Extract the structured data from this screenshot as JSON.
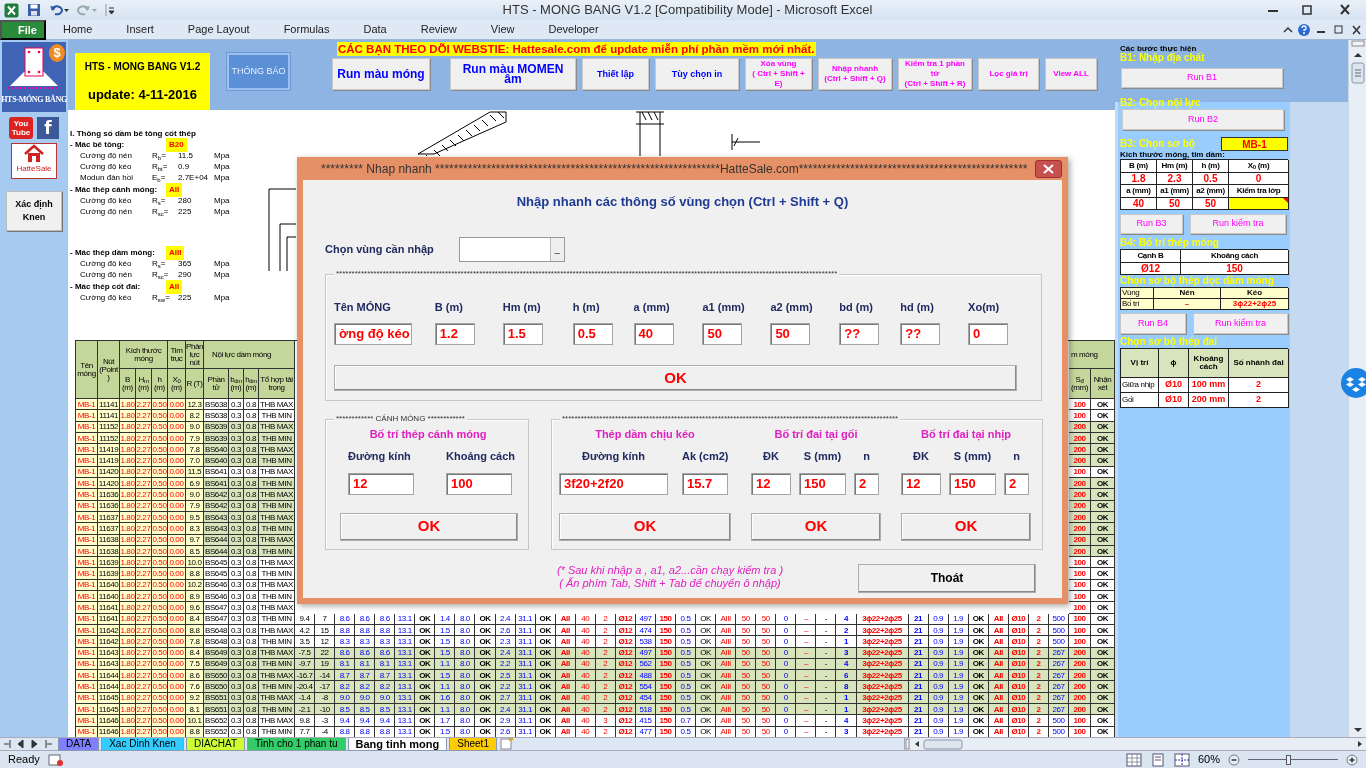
{
  "window": {
    "title": "HTS - MONG BANG V1.2  [Compatibility Mode]  -  Microsoft Excel"
  },
  "ribbon_tabs": [
    {
      "label": "File",
      "kind": "file"
    },
    {
      "label": "Home",
      "kind": "tab"
    },
    {
      "label": "Insert",
      "kind": "tab"
    },
    {
      "label": "Page Layout",
      "kind": "tab"
    },
    {
      "label": "Formulas",
      "kind": "tab"
    },
    {
      "label": "Data",
      "kind": "tab"
    },
    {
      "label": "Review",
      "kind": "tab"
    },
    {
      "label": "View",
      "kind": "tab"
    },
    {
      "label": "Developer",
      "kind": "tab"
    }
  ],
  "side": {
    "logo_caption": "HTS-MÓNG BĂNG",
    "logo_badge": "$",
    "links": [
      {
        "kind": "youtube",
        "label": "You Tube"
      },
      {
        "kind": "facebook",
        "label": "f"
      }
    ],
    "shop_caption": "HatteSale",
    "knen_button": "Xác định Knen"
  },
  "banner": {
    "title": "HTS - MONG BANG V1.2",
    "update": "update: 4-11-2016",
    "notice_button": "THÔNG BÁO",
    "marquee": "CÁC BẠN THEO DÕI WEBSTIE: Hattesale.com để update miễn phí phần mềm mới nhất.",
    "buttons": [
      {
        "label": "Run màu móng",
        "kind": "large"
      },
      {
        "label": "Run màu MOMEN âm",
        "kind": "large"
      },
      {
        "label": "Thiết lập",
        "kind": "small"
      },
      {
        "label": "Tùy chọn in",
        "kind": "small"
      },
      {
        "label": "Xóa vùng\n( Ctrl + Shift + E)",
        "kind": "shortcut"
      },
      {
        "label": "Nhập nhanh\n(Ctrl + Shift + Q)",
        "kind": "shortcut"
      },
      {
        "label": "Kiểm tra 1 phần tử\n(Ctrl + Shift + R)",
        "kind": "shortcut"
      },
      {
        "label": "Lọc giá trị",
        "kind": "shortcut"
      },
      {
        "label": "View ALL",
        "kind": "shortcut"
      }
    ]
  },
  "params": {
    "heading": "I. Thông số dầm bê tông cốt thép",
    "groups": [
      {
        "label": "- Mác bê tông:",
        "grade": "B20",
        "items": [
          {
            "label": "Cường độ nén",
            "symbol": "R$_{b}$=",
            "value": "11.5",
            "unit": "Mpa"
          },
          {
            "label": "Cường độ kéo",
            "symbol": "R$_{bt}$=",
            "value": "0.9",
            "unit": "Mpa"
          },
          {
            "label": "Modun đàn hồi",
            "symbol": "E$_{b}$=",
            "value": "2.7E+04",
            "unit": "Mpa"
          }
        ]
      },
      {
        "label": "- Mác thép cánh móng:",
        "grade": "AII",
        "items": [
          {
            "label": "Cường độ kéo",
            "symbol": "R$_{s}$=",
            "value": "280",
            "unit": "Mpa"
          },
          {
            "label": "Cường độ nén",
            "symbol": "R$_{sc}$=",
            "value": "225",
            "unit": "Mpa"
          }
        ]
      },
      {
        "label": "- Mác thép dầm móng:",
        "grade": "AIII",
        "items": [
          {
            "label": "Cường độ kéo",
            "symbol": "R$_{s}$=",
            "value": "365",
            "unit": "Mpa"
          },
          {
            "label": "Cường độ nén",
            "symbol": "R$_{sc}$=",
            "value": "290",
            "unit": "Mpa"
          }
        ]
      },
      {
        "label": "- Mác thép cốt đai:",
        "grade": "AII",
        "items": [
          {
            "label": "Cường độ kéo",
            "symbol": "R$_{sw}$=",
            "value": "225",
            "unit": "Mpa"
          }
        ]
      }
    ]
  },
  "table": {
    "left_columns": [
      {
        "label": "Tên móng"
      },
      {
        "label": "Nút (Point )"
      },
      {
        "label": "Kích thước móng",
        "children": [
          {
            "label": "B (m)"
          },
          {
            "label": "H$_{m}$ (m)"
          },
          {
            "label": "h (m)"
          }
        ]
      },
      {
        "label": "Tim trục",
        "children": [
          {
            "label": "X$_{0}$ (m)"
          }
        ]
      },
      {
        "label": "Phản lực nút",
        "children": [
          {
            "label": "R (T)"
          }
        ]
      },
      {
        "label": "Nội lực dầm móng",
        "children": [
          {
            "label": "Phần tử"
          },
          {
            "label": "b$_{dm}$ (m)"
          },
          {
            "label": "h$_{dm}$ (m)"
          },
          {
            "label": "Tổ hợp tải trọng"
          }
        ]
      }
    ],
    "right_columns": [
      {
        "label": "m móng",
        "children": [
          {
            "label": "S$_{đ}$ (mm)"
          },
          {
            "label": "Nhận xét"
          }
        ]
      }
    ],
    "rows": [
      {
        "kind": "partial",
        "highlighted": false,
        "cells": [
          "MB-1",
          "11141",
          "1.80",
          "2.27",
          "0.50",
          "0.00",
          "12.3",
          "BS638",
          "0.3",
          "0.8",
          "THB MAX",
          "100",
          "OK"
        ]
      },
      {
        "kind": "partial",
        "highlighted": false,
        "cells": [
          "MB-1",
          "11141",
          "1.80",
          "2.27",
          "0.50",
          "0.00",
          "8.2",
          "BS638",
          "0.3",
          "0.8",
          "THB MIN",
          "100",
          "OK"
        ]
      },
      {
        "kind": "partial",
        "highlighted": true,
        "cells": [
          "MB-1",
          "11152",
          "1.80",
          "2.27",
          "0.50",
          "0.00",
          "9.0",
          "BS639",
          "0.3",
          "0.8",
          "THB MAX",
          "200",
          "OK"
        ]
      },
      {
        "kind": "partial",
        "highlighted": true,
        "cells": [
          "MB-1",
          "11152",
          "1.80",
          "2.27",
          "0.50",
          "0.00",
          "7.9",
          "BS639",
          "0.3",
          "0.8",
          "THB MIN",
          "200",
          "OK"
        ]
      },
      {
        "kind": "partial",
        "highlighted": true,
        "cells": [
          "MB-1",
          "11419",
          "1.80",
          "2.27",
          "0.50",
          "0.00",
          "7.8",
          "BS640",
          "0.3",
          "0.8",
          "THB MAX",
          "200",
          "OK"
        ]
      },
      {
        "kind": "partial",
        "highlighted": true,
        "cells": [
          "MB-1",
          "11419",
          "1.80",
          "2.27",
          "0.50",
          "0.00",
          "7.0",
          "BS640",
          "0.3",
          "0.8",
          "THB MIN",
          "200",
          "OK"
        ]
      },
      {
        "kind": "partial",
        "highlighted": false,
        "cells": [
          "MB-1",
          "11420",
          "1.80",
          "2.27",
          "0.50",
          "0.00",
          "11.5",
          "BS641",
          "0.3",
          "0.8",
          "THB MAX",
          "100",
          "OK"
        ]
      },
      {
        "kind": "partial",
        "highlighted": true,
        "cells": [
          "MB-1",
          "11420",
          "1.80",
          "2.27",
          "0.50",
          "0.00",
          "6.9",
          "BS641",
          "0.3",
          "0.8",
          "THB MIN",
          "200",
          "OK"
        ]
      },
      {
        "kind": "partial",
        "highlighted": true,
        "cells": [
          "MB-1",
          "11636",
          "1.80",
          "2.27",
          "0.50",
          "0.00",
          "9.0",
          "BS642",
          "0.3",
          "0.8",
          "THB MAX",
          "200",
          "OK"
        ]
      },
      {
        "kind": "partial",
        "highlighted": true,
        "cells": [
          "MB-1",
          "11636",
          "1.80",
          "2.27",
          "0.50",
          "0.00",
          "7.9",
          "BS642",
          "0.3",
          "0.8",
          "THB MIN",
          "200",
          "OK"
        ]
      },
      {
        "kind": "partial",
        "highlighted": true,
        "cells": [
          "MB-1",
          "11637",
          "1.80",
          "2.27",
          "0.50",
          "0.00",
          "9.5",
          "BS643",
          "0.3",
          "0.8",
          "THB MAX",
          "200",
          "OK"
        ]
      },
      {
        "kind": "partial",
        "highlighted": true,
        "cells": [
          "MB-1",
          "11637",
          "1.80",
          "2.27",
          "0.50",
          "0.00",
          "8.3",
          "BS643",
          "0.3",
          "0.8",
          "THB MIN",
          "200",
          "OK"
        ]
      },
      {
        "kind": "partial",
        "highlighted": true,
        "cells": [
          "MB-1",
          "11638",
          "1.80",
          "2.27",
          "0.50",
          "0.00",
          "9.7",
          "BS644",
          "0.3",
          "0.8",
          "THB MAX",
          "200",
          "OK"
        ]
      },
      {
        "kind": "partial",
        "highlighted": true,
        "cells": [
          "MB-1",
          "11638",
          "1.80",
          "2.27",
          "0.50",
          "0.00",
          "8.5",
          "BS644",
          "0.3",
          "0.8",
          "THB MIN",
          "200",
          "OK"
        ]
      },
      {
        "kind": "partial",
        "highlighted": false,
        "cells": [
          "MB-1",
          "11639",
          "1.80",
          "2.27",
          "0.50",
          "0.00",
          "10.0",
          "BS645",
          "0.3",
          "0.8",
          "THB MAX",
          "100",
          "OK"
        ]
      },
      {
        "kind": "partial",
        "highlighted": false,
        "cells": [
          "MB-1",
          "11639",
          "1.80",
          "2.27",
          "0.50",
          "0.00",
          "8.8",
          "BS645",
          "0.3",
          "0.8",
          "THB MIN",
          "100",
          "OK"
        ]
      },
      {
        "kind": "partial",
        "highlighted": false,
        "cells": [
          "MB-1",
          "11640",
          "1.80",
          "2.27",
          "0.50",
          "0.00",
          "10.2",
          "BS646",
          "0.3",
          "0.8",
          "THB MAX",
          "100",
          "OK"
        ]
      },
      {
        "kind": "partial",
        "highlighted": false,
        "cells": [
          "MB-1",
          "11640",
          "1.80",
          "2.27",
          "0.50",
          "0.00",
          "8.9",
          "BS646",
          "0.3",
          "0.8",
          "THB MIN",
          "100",
          "OK"
        ]
      },
      {
        "kind": "partial",
        "highlighted": false,
        "cells": [
          "MB-1",
          "11641",
          "1.80",
          "2.27",
          "0.50",
          "0.00",
          "9.6",
          "BS647",
          "0.3",
          "0.8",
          "THB MAX",
          "100",
          "OK"
        ]
      },
      {
        "kind": "full",
        "highlighted": false,
        "cells": [
          "MB-1",
          "11641",
          "1.80",
          "2.27",
          "0.50",
          "0.00",
          "8.4",
          "BS647",
          "0.3",
          "0.8",
          "THB MIN",
          "9.4",
          "7",
          "8.6",
          "8.6",
          "8.6",
          "13.1",
          "OK",
          "1.4",
          "8.0",
          "OK",
          "2.4",
          "31.1",
          "OK",
          "AII",
          "40",
          "2",
          "Ø12",
          "497",
          "150",
          "0.5",
          "OK",
          "AIII",
          "50",
          "50",
          "0",
          "–",
          "-",
          "4",
          "3ϕ22+2ϕ25",
          "21",
          "0.9",
          "1.9",
          "OK",
          "AII",
          "Ø10",
          "2",
          "500",
          "100",
          "OK"
        ]
      },
      {
        "kind": "full",
        "highlighted": false,
        "cells": [
          "MB-1",
          "11642",
          "1.80",
          "2.27",
          "0.50",
          "0.00",
          "8.8",
          "BS648",
          "0.3",
          "0.8",
          "THB MAX",
          "4.2",
          "15",
          "8.8",
          "8.8",
          "8.8",
          "13.1",
          "OK",
          "1.5",
          "8.0",
          "OK",
          "2.6",
          "31.1",
          "OK",
          "AII",
          "40",
          "2",
          "Ø12",
          "474",
          "150",
          "0.5",
          "OK",
          "AIII",
          "50",
          "50",
          "0",
          "–",
          "-",
          "2",
          "3ϕ22+2ϕ25",
          "21",
          "0.9",
          "1.9",
          "OK",
          "AII",
          "Ø10",
          "2",
          "500",
          "100",
          "OK"
        ]
      },
      {
        "kind": "full",
        "highlighted": false,
        "cells": [
          "MB-1",
          "11642",
          "1.80",
          "2.27",
          "0.50",
          "0.00",
          "7.8",
          "BS648",
          "0.3",
          "0.8",
          "THB MIN",
          "3.5",
          "12",
          "8.3",
          "8.3",
          "8.3",
          "13.1",
          "OK",
          "1.5",
          "8.0",
          "OK",
          "2.3",
          "31.1",
          "OK",
          "AII",
          "40",
          "2",
          "Ø12",
          "538",
          "150",
          "0.5",
          "OK",
          "AIII",
          "50",
          "50",
          "0",
          "–",
          "-",
          "1",
          "3ϕ22+2ϕ25",
          "21",
          "0.9",
          "1.9",
          "OK",
          "AII",
          "Ø10",
          "2",
          "500",
          "100",
          "OK"
        ]
      },
      {
        "kind": "full",
        "highlighted": true,
        "cells": [
          "MB-1",
          "11643",
          "1.80",
          "2.27",
          "0.50",
          "0.00",
          "8.4",
          "BS649",
          "0.3",
          "0.8",
          "THB MAX",
          "-7.5",
          "22",
          "8.6",
          "8.6",
          "8.6",
          "13.1",
          "OK",
          "1.5",
          "8.0",
          "OK",
          "2.4",
          "31.1",
          "OK",
          "AII",
          "40",
          "2",
          "Ø12",
          "497",
          "150",
          "0.5",
          "OK",
          "AIII",
          "50",
          "50",
          "0",
          "–",
          "-",
          "3",
          "3ϕ22+2ϕ25",
          "21",
          "0.9",
          "1.9",
          "OK",
          "AII",
          "Ø10",
          "2",
          "267",
          "200",
          "OK"
        ]
      },
      {
        "kind": "full",
        "highlighted": true,
        "cells": [
          "MB-1",
          "11643",
          "1.80",
          "2.27",
          "0.50",
          "0.00",
          "7.5",
          "BS649",
          "0.3",
          "0.8",
          "THB MIN",
          "-9.7",
          "19",
          "8.1",
          "8.1",
          "8.1",
          "13.1",
          "OK",
          "1.1",
          "8.0",
          "OK",
          "2.2",
          "31.1",
          "OK",
          "AII",
          "40",
          "2",
          "Ø12",
          "562",
          "150",
          "0.5",
          "OK",
          "AIII",
          "50",
          "50",
          "0",
          "–",
          "-",
          "4",
          "3ϕ22+2ϕ25",
          "21",
          "0.9",
          "1.9",
          "OK",
          "AII",
          "Ø10",
          "2",
          "267",
          "200",
          "OK"
        ]
      },
      {
        "kind": "full",
        "highlighted": true,
        "cells": [
          "MB-1",
          "11644",
          "1.80",
          "2.27",
          "0.50",
          "0.00",
          "8.6",
          "BS650",
          "0.3",
          "0.8",
          "THB MAX",
          "-16.7",
          "-14",
          "8.7",
          "8.7",
          "8.7",
          "13.1",
          "OK",
          "1.5",
          "8.0",
          "OK",
          "2.5",
          "31.1",
          "OK",
          "AII",
          "40",
          "2",
          "Ø12",
          "488",
          "150",
          "0.5",
          "OK",
          "AIII",
          "50",
          "50",
          "0",
          "–",
          "-",
          "6",
          "3ϕ22+2ϕ25",
          "21",
          "0.9",
          "1.9",
          "OK",
          "AII",
          "Ø10",
          "2",
          "267",
          "200",
          "OK"
        ]
      },
      {
        "kind": "full",
        "highlighted": true,
        "cells": [
          "MB-1",
          "11644",
          "1.80",
          "2.27",
          "0.50",
          "0.00",
          "7.6",
          "BS650",
          "0.3",
          "0.8",
          "THB MIN",
          "-20.4",
          "-17",
          "8.2",
          "8.2",
          "8.2",
          "13.1",
          "OK",
          "1.1",
          "8.0",
          "OK",
          "2.2",
          "31.1",
          "OK",
          "AII",
          "40",
          "2",
          "Ø12",
          "554",
          "150",
          "0.5",
          "OK",
          "AIII",
          "50",
          "50",
          "0",
          "–",
          "-",
          "8",
          "3ϕ22+2ϕ25",
          "21",
          "0.9",
          "1.9",
          "OK",
          "AII",
          "Ø10",
          "2",
          "267",
          "200",
          "OK"
        ]
      },
      {
        "kind": "full",
        "highlighted": true,
        "cells": [
          "MB-1",
          "11645",
          "1.80",
          "2.27",
          "0.50",
          "0.00",
          "9.2",
          "BS651",
          "0.3",
          "0.8",
          "THB MAX",
          "-1.4",
          "-8",
          "9.0",
          "9.0",
          "9.0",
          "13.1",
          "OK",
          "1.6",
          "8.0",
          "OK",
          "2.7",
          "31.1",
          "OK",
          "AII",
          "40",
          "2",
          "Ø12",
          "454",
          "150",
          "0.5",
          "OK",
          "AIII",
          "50",
          "50",
          "0",
          "–",
          "-",
          "1",
          "3ϕ22+2ϕ25",
          "21",
          "0.9",
          "1.9",
          "OK",
          "AII",
          "Ø10",
          "2",
          "267",
          "200",
          "OK"
        ]
      },
      {
        "kind": "full",
        "highlighted": true,
        "cells": [
          "MB-1",
          "11645",
          "1.80",
          "2.27",
          "0.50",
          "0.00",
          "8.1",
          "BS651",
          "0.3",
          "0.8",
          "THB MIN",
          "-2.1",
          "-10",
          "8.5",
          "8.5",
          "8.5",
          "13.1",
          "OK",
          "1.1",
          "8.0",
          "OK",
          "2.4",
          "31.1",
          "OK",
          "AII",
          "40",
          "2",
          "Ø12",
          "518",
          "150",
          "0.5",
          "OK",
          "AIII",
          "50",
          "50",
          "0",
          "–",
          "-",
          "1",
          "3ϕ22+2ϕ25",
          "21",
          "0.9",
          "1.9",
          "OK",
          "AII",
          "Ø10",
          "2",
          "267",
          "200",
          "OK"
        ]
      },
      {
        "kind": "full",
        "highlighted": false,
        "cells": [
          "MB-1",
          "11646",
          "1.80",
          "2.27",
          "0.50",
          "0.00",
          "10.1",
          "BS652",
          "0.3",
          "0.8",
          "THB MAX",
          "9.8",
          "-3",
          "9.4",
          "9.4",
          "9.4",
          "13.1",
          "OK",
          "1.7",
          "8.0",
          "OK",
          "2.9",
          "31.1",
          "OK",
          "AII",
          "40",
          "3",
          "Ø12",
          "415",
          "150",
          "0.7",
          "OK",
          "AIII",
          "50",
          "50",
          "0",
          "–",
          "-",
          "4",
          "3ϕ22+2ϕ25",
          "21",
          "0.9",
          "1.9",
          "OK",
          "AII",
          "Ø10",
          "2",
          "500",
          "100",
          "OK"
        ]
      },
      {
        "kind": "full",
        "highlighted": false,
        "cells": [
          "MB-1",
          "11646",
          "1.80",
          "2.27",
          "0.50",
          "0.00",
          "8.8",
          "BS652",
          "0.3",
          "0.8",
          "THB MIN",
          "7.7",
          "-4",
          "8.8",
          "8.8",
          "8.8",
          "13.1",
          "OK",
          "1.5",
          "8.0",
          "OK",
          "2.6",
          "31.1",
          "OK",
          "AII",
          "40",
          "2",
          "Ø12",
          "477",
          "150",
          "0.5",
          "OK",
          "AIII",
          "50",
          "50",
          "0",
          "–",
          "-",
          "3",
          "3ϕ22+2ϕ25",
          "21",
          "0.9",
          "1.9",
          "OK",
          "AII",
          "Ø10",
          "2",
          "500",
          "100",
          "OK"
        ]
      }
    ]
  },
  "dialog": {
    "title": "********* Nhap nhanh *************************************************************HatteSale.com*************************************************",
    "heading": "Nhập nhanh các thông số vùng chọn (Ctrl + Shift + Q)",
    "range_label": "Chọn vùng cần nhập",
    "range_button": "_",
    "main_frame": {
      "caption": "*****************************************************************************************************************************************************************",
      "fields": [
        {
          "label": "Tên MÓNG",
          "value": "ờng độ kéo"
        },
        {
          "label": "B (m)",
          "value": "1.2"
        },
        {
          "label": "Hm (m)",
          "value": "1.5"
        },
        {
          "label": "h (m)",
          "value": "0.5"
        },
        {
          "label": "a (mm)",
          "value": "40"
        },
        {
          "label": "a1 (mm)",
          "value": "50"
        },
        {
          "label": "a2 (mm)",
          "value": "50"
        },
        {
          "label": "bd (m)",
          "value": "??"
        },
        {
          "label": "hd (m)",
          "value": "??"
        },
        {
          "label": "Xo(m)",
          "value": "0"
        }
      ],
      "ok": "OK"
    },
    "wing_frame": {
      "caption": "************ CÁNH MÓNG ************",
      "heading": "Bố trí thép cánh móng",
      "fields": [
        {
          "label": "Đường kính",
          "value": "12"
        },
        {
          "label": "Khoảng cách",
          "value": "100"
        }
      ],
      "ok": "OK"
    },
    "beam_frame": {
      "caption": "************************************************************************************************************",
      "groups": [
        {
          "heading": "Thép dầm chịu kéo",
          "fields": [
            {
              "label": "Đường kính",
              "value": "3f20+2f20"
            },
            {
              "label": "Ak (cm2)",
              "value": "15.7"
            }
          ],
          "ok": "OK"
        },
        {
          "heading": "Bố trí đai tại gối",
          "fields": [
            {
              "label": "ĐK",
              "value": "12"
            },
            {
              "label": "S (mm)",
              "value": "150"
            },
            {
              "label": "n",
              "value": "2"
            }
          ],
          "ok": "OK"
        },
        {
          "heading": "Bố trí đai tại nhịp",
          "fields": [
            {
              "label": "ĐK",
              "value": "12"
            },
            {
              "label": "S (mm)",
              "value": "150"
            },
            {
              "label": "n",
              "value": "2"
            }
          ],
          "ok": "OK"
        }
      ]
    },
    "notes": [
      "(* Sau khi nhập a , a1, a2...cần chạy kiểm tra )",
      "( Ấn phím Tab, Shift + Tab để chuyển ô  nhập)"
    ],
    "exit_button": "Thoát"
  },
  "panel": {
    "caption": "Các bước thực hiện",
    "b1": "B1: Nhập địa chất",
    "b1_button": "Run B1",
    "b2": "B2: Chọn nội lực",
    "b2_button": "Run B2",
    "b3": "B3: Chọn sơ bộ",
    "b3_value": "MB-1",
    "size_caption": "Kích thước móng, tim dầm:",
    "size_table": [
      {
        "kind": "head",
        "cells": [
          "B (m)",
          "Hm (m)",
          "h (m)",
          "X$_{0}$ (m)"
        ]
      },
      {
        "kind": "value",
        "cells": [
          "1.8",
          "2.3",
          "0.5",
          "0"
        ]
      },
      {
        "kind": "head",
        "cells": [
          "a (mm)",
          "a1 (mm)",
          "a2 (mm)",
          "Kiểm tra lớp"
        ]
      },
      {
        "kind": "value",
        "flagged": true,
        "cells": [
          "40",
          "50",
          "50"
        ]
      }
    ],
    "b3_buttons": [
      "Run B3",
      "Run kiểm tra"
    ],
    "b4": "B4: Bố trí thép móng",
    "b4_table": [
      {
        "kind": "head",
        "cells": [
          "Cạnh B",
          "Khoảng cách"
        ]
      },
      {
        "kind": "value",
        "cells": [
          "Ø12",
          "150"
        ]
      }
    ],
    "long_title": "Chọn sơ bộ thép dọc dầm móng",
    "long_table": [
      {
        "kind": "yhead",
        "cells": [
          "Vùng",
          "Nén",
          "Kéo"
        ]
      },
      {
        "kind": "yvalue",
        "cells": [
          "Bố trí",
          "–",
          "3ϕ22+2ϕ25"
        ]
      }
    ],
    "b4_buttons": [
      "Run B4",
      "Run kiểm tra"
    ],
    "stirrup_title": "Chọn sơ bộ thép đai",
    "stirrup_table": [
      {
        "kind": "ghead",
        "cells": [
          "Vị trí",
          "ϕ",
          "Khoảng cách",
          "Số nhánh đai"
        ]
      },
      {
        "kind": "lvalue",
        "cells": [
          "Giữa nhịp",
          "Ø10",
          "100 mm",
          "2"
        ]
      },
      {
        "kind": "lvalue",
        "cells": [
          "Gối",
          "Ø10",
          "200 mm",
          "2"
        ]
      }
    ]
  },
  "sheet_tabs": [
    {
      "label": "DATA",
      "selected": false,
      "color": "#7f7fff"
    },
    {
      "label": "Xac Dinh Knen",
      "selected": false,
      "color": "#33ccff"
    },
    {
      "label": "DIACHAT",
      "selected": false,
      "color": "#ccff33"
    },
    {
      "label": "Tinh cho 1 phan tu",
      "selected": false,
      "color": "#33cc66"
    },
    {
      "label": "Bang tinh mong",
      "selected": true,
      "color": "#ffffff"
    },
    {
      "label": "Sheet1",
      "selected": false,
      "color": "#ffcc00"
    }
  ],
  "status_bar": {
    "text": "Ready",
    "zoom": "60%",
    "zoom_slider": {
      "level": 0.45
    }
  }
}
